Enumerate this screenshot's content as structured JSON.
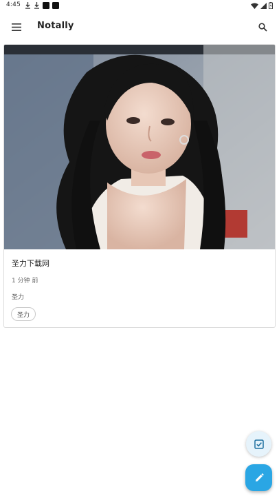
{
  "status_bar": {
    "time": "4:45",
    "left_icons": [
      "download-icon",
      "download-icon",
      "app-notification-icon",
      "app-notification-icon"
    ],
    "right_icons": [
      "wifi-icon",
      "signal-icon",
      "battery-icon"
    ]
  },
  "app_bar": {
    "title": "Notally",
    "menu_icon": "menu-icon",
    "search_icon": "search-icon"
  },
  "notes": [
    {
      "image": "photo",
      "title": "圣力下载网",
      "time": "1 分钟 前",
      "body": "圣力",
      "labels": [
        "圣力"
      ]
    }
  ],
  "fabs": {
    "small_icon": "checklist-icon",
    "large_icon": "edit-pencil-icon",
    "accent": "#2aa6e4",
    "small_bg": "#e6f3fb"
  }
}
